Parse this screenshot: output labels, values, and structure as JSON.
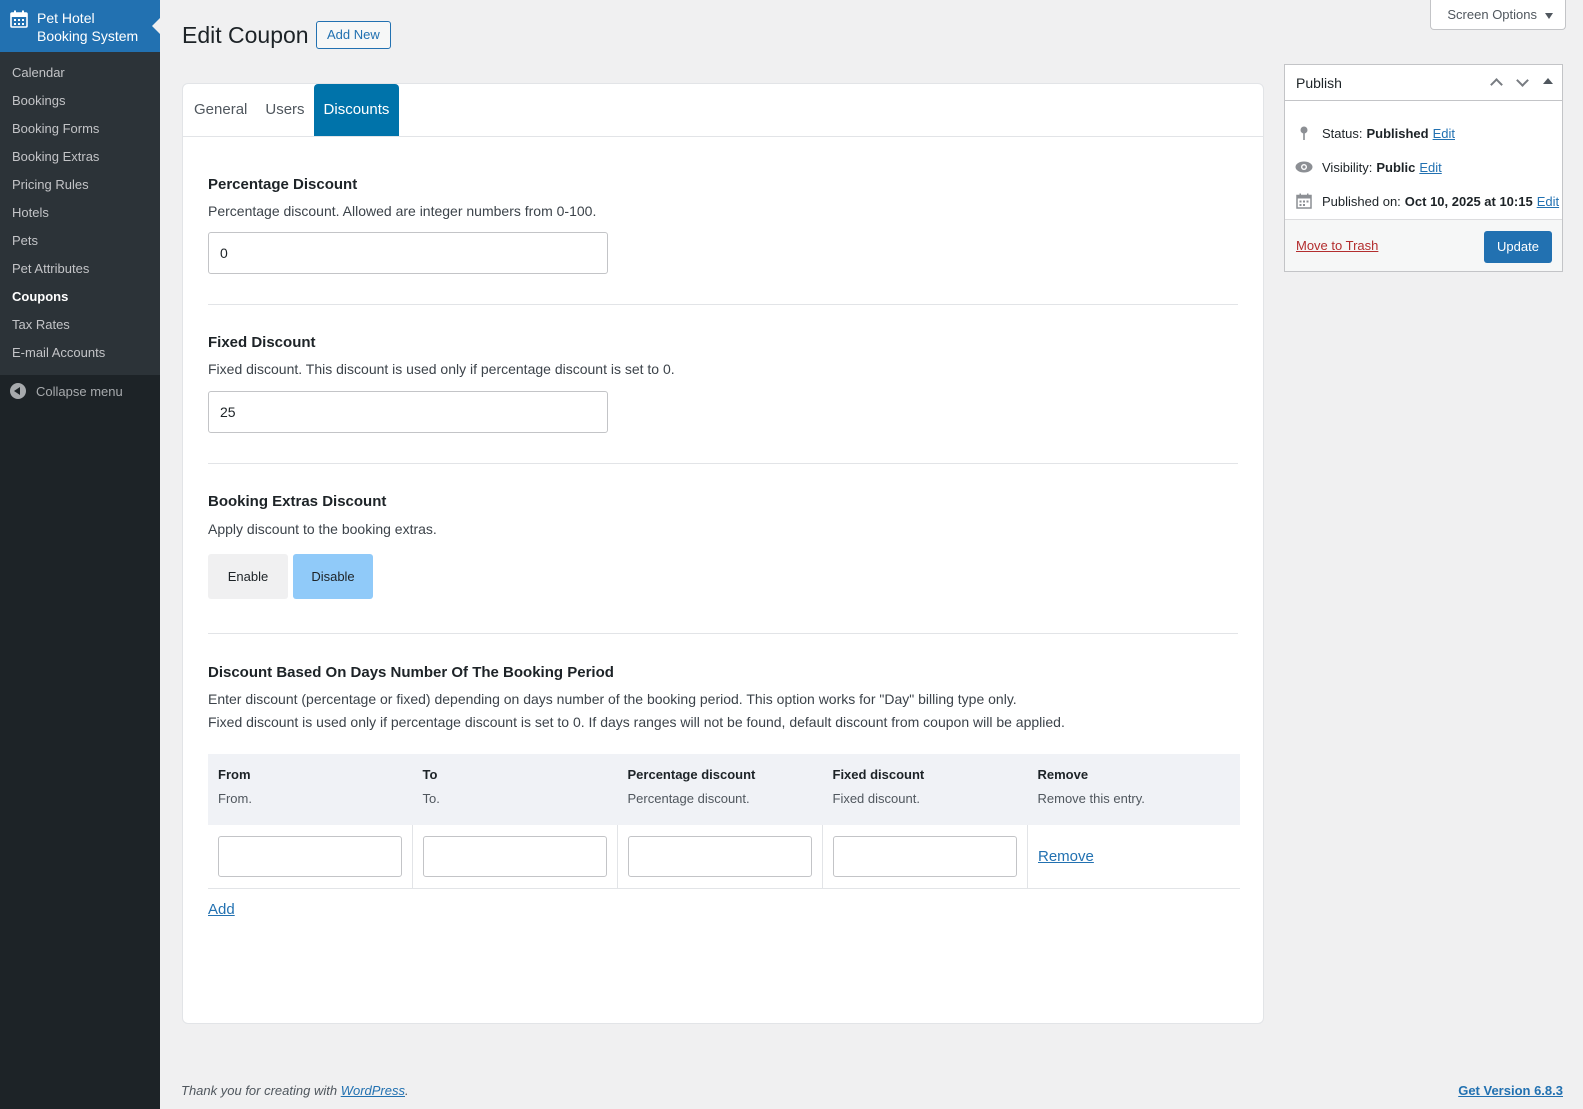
{
  "sidebar": {
    "header_line1": "Pet Hotel",
    "header_line2": "Booking System",
    "items": [
      {
        "label": "Calendar"
      },
      {
        "label": "Bookings"
      },
      {
        "label": "Booking Forms"
      },
      {
        "label": "Booking Extras"
      },
      {
        "label": "Pricing Rules"
      },
      {
        "label": "Hotels"
      },
      {
        "label": "Pets"
      },
      {
        "label": "Pet Attributes"
      },
      {
        "label": "Coupons",
        "current": true
      },
      {
        "label": "Tax Rates"
      },
      {
        "label": "E-mail Accounts"
      }
    ],
    "collapse_label": "Collapse menu"
  },
  "header": {
    "title": "Edit Coupon",
    "add_new_label": "Add New",
    "screen_options_label": "Screen Options"
  },
  "tabs": [
    {
      "label": "General"
    },
    {
      "label": "Users"
    },
    {
      "label": "Discounts",
      "active": true
    }
  ],
  "percentage": {
    "title": "Percentage Discount",
    "description": "Percentage discount. Allowed are integer numbers from 0-100.",
    "value": "0"
  },
  "fixed": {
    "title": "Fixed Discount",
    "description": "Fixed discount. This discount is used only if percentage discount is set to 0.",
    "value": "25"
  },
  "extras": {
    "title": "Booking Extras Discount",
    "description": "Apply discount to the booking extras.",
    "enable_label": "Enable",
    "disable_label": "Disable",
    "selected": "Disable"
  },
  "days": {
    "title": "Discount Based On Days Number Of The Booking Period",
    "description_line1": "Enter discount (percentage or fixed) depending on days number of the booking period. This option works for \"Day\" billing type only.",
    "description_line2": "Fixed discount is used only if percentage discount is set to 0. If days ranges will not be found, default discount from coupon will be applied.",
    "columns": [
      {
        "label": "From",
        "desc": "From."
      },
      {
        "label": "To",
        "desc": "To."
      },
      {
        "label": "Percentage discount",
        "desc": "Percentage discount."
      },
      {
        "label": "Fixed discount",
        "desc": "Fixed discount."
      },
      {
        "label": "Remove",
        "desc": "Remove this entry."
      }
    ],
    "remove_label": "Remove",
    "add_label": "Add"
  },
  "publish": {
    "title": "Publish",
    "status_label": "Status:",
    "status_value": "Published",
    "visibility_label": "Visibility:",
    "visibility_value": "Public",
    "published_label": "Published on:",
    "published_value": "Oct 10, 2025 at 10:15",
    "edit_label": "Edit",
    "trash_label": "Move to Trash",
    "update_label": "Update"
  },
  "footer": {
    "thanks_prefix": "Thank you for creating with",
    "wordpress_link": "WordPress",
    "thanks_suffix": ".",
    "version_label": "Get Version 6.8.3"
  },
  "colors": {
    "accent": "#2271b1",
    "tab_active": "#0073aa",
    "disable_selected": "#90caf9",
    "sidebar_bg": "#1d2327"
  }
}
